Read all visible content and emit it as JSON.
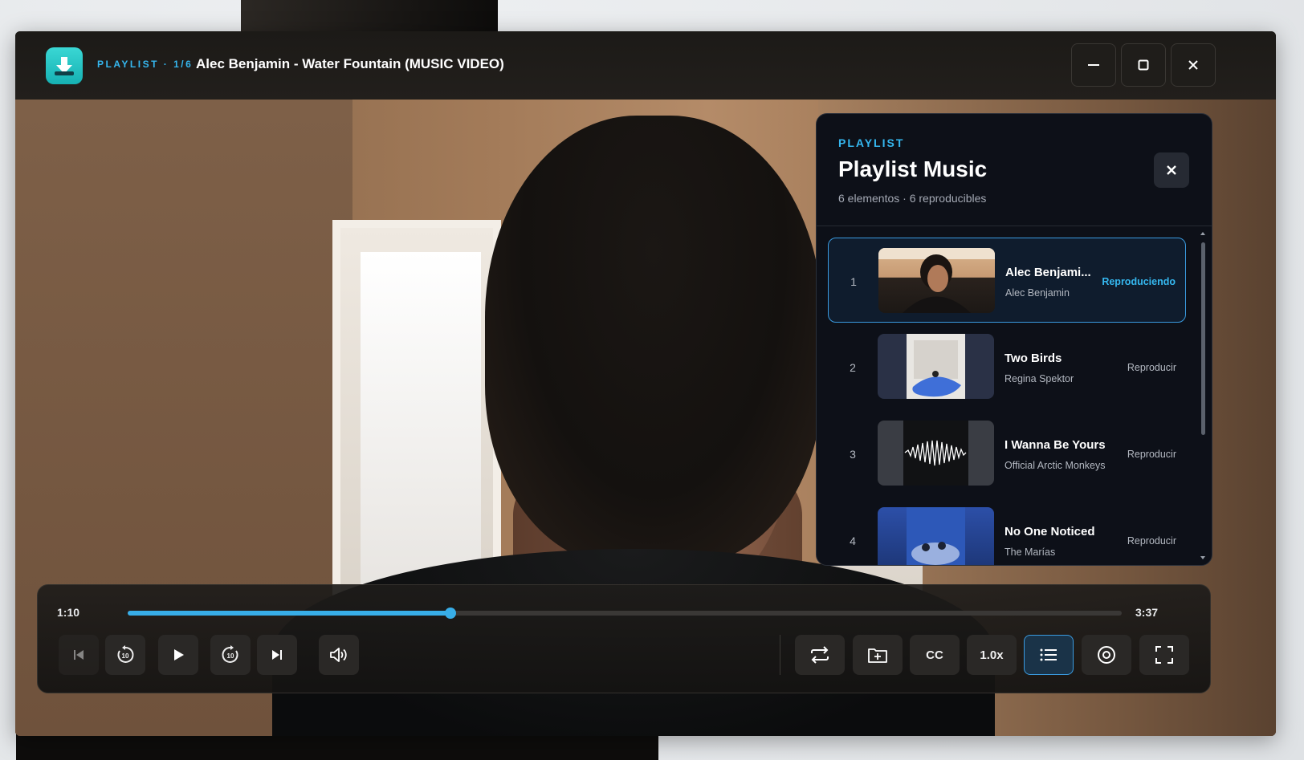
{
  "window": {
    "kicker": "PLAYLIST · 1/6",
    "title": "Alec Benjamin - Water Fountain (MUSIC VIDEO)"
  },
  "window_controls": {
    "minimize": "minimize-icon",
    "maximize": "maximize-icon",
    "close": "close-icon"
  },
  "playlist": {
    "kicker": "PLAYLIST",
    "title": "Playlist Music",
    "subtitle": "6 elementos · 6 reproducibles",
    "items": [
      {
        "num": "1",
        "title": "Alec Benjami...",
        "artist": "Alec Benjamin",
        "status": "Reproduciendo",
        "active": true
      },
      {
        "num": "2",
        "title": "Two Birds",
        "artist": "Regina Spektor",
        "status": "Reproducir",
        "active": false
      },
      {
        "num": "3",
        "title": "I Wanna Be Yours",
        "artist": "Official Arctic Monkeys",
        "status": "Reproducir",
        "active": false
      },
      {
        "num": "4",
        "title": "No One Noticed",
        "artist": "The Marías",
        "status": "Reproducir",
        "active": false
      }
    ]
  },
  "player": {
    "current_time": "1:10",
    "duration": "3:37",
    "progress": 0.325,
    "speed_label": "1.0x",
    "cc_label": "CC",
    "accent_color": "#38aee8"
  }
}
